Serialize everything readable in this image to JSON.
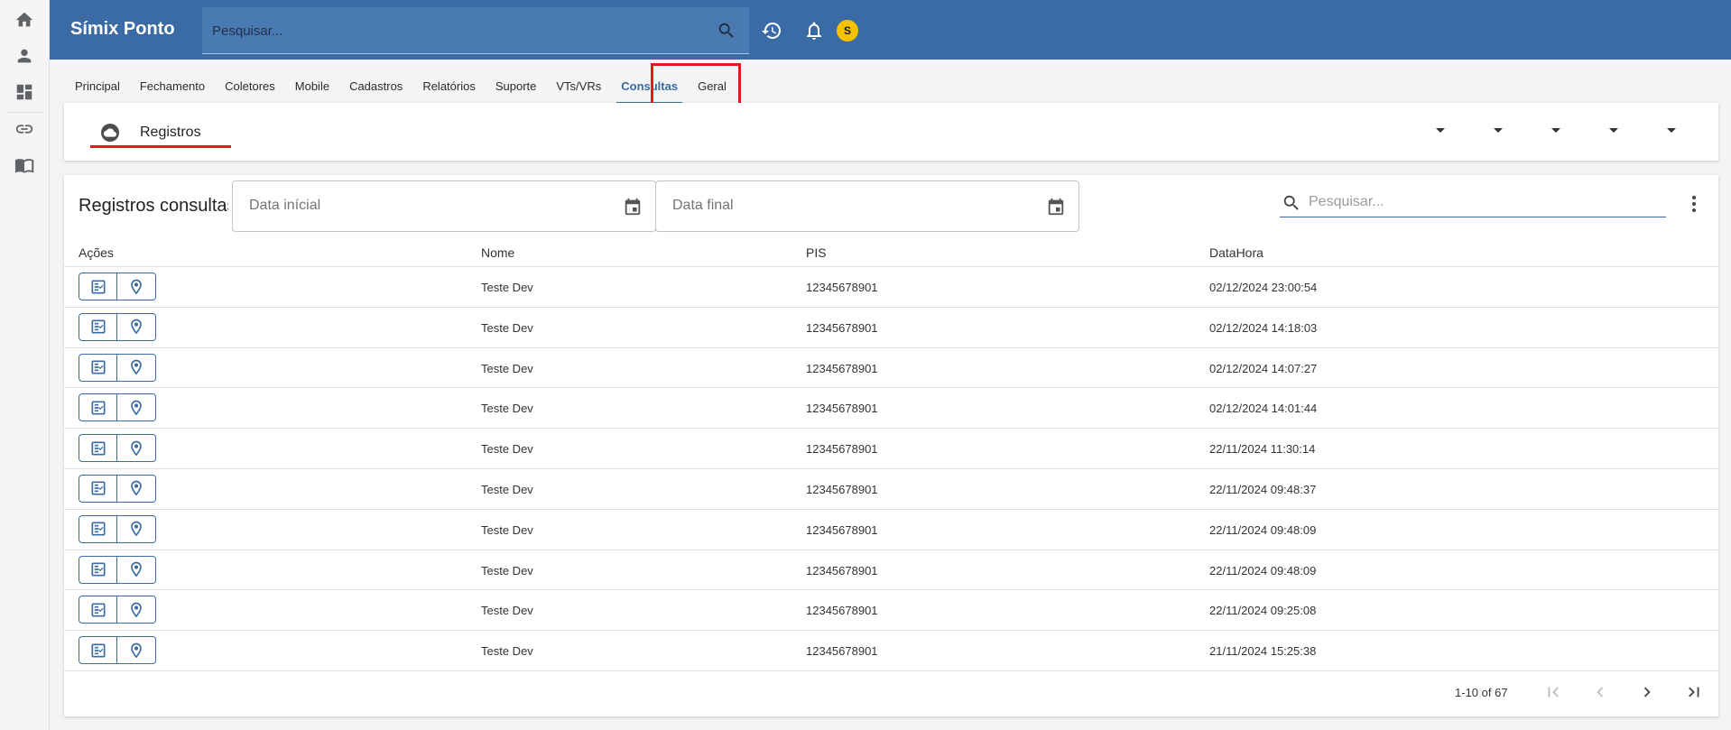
{
  "app": {
    "title": "Símix Ponto",
    "search_placeholder": "Pesquisar...",
    "avatar_initial": "S"
  },
  "nav": [
    "Principal",
    "Fechamento",
    "Coletores",
    "Mobile",
    "Cadastros",
    "Relatórios",
    "Suporte",
    "VTs/VRs",
    "Consultas",
    "Geral"
  ],
  "nav_active": "Consultas",
  "subnav": {
    "tab_label": "Registros"
  },
  "card": {
    "title": "Registros consultas",
    "start_date_placeholder": "Data inícial",
    "end_date_placeholder": "Data final",
    "search_placeholder": "Pesquisar..."
  },
  "table": {
    "headers": {
      "actions": "Ações",
      "name": "Nome",
      "pis": "PIS",
      "datetime": "DataHora"
    },
    "rows": [
      {
        "name": "Teste Dev",
        "pis": "12345678901",
        "datetime": "02/12/2024 23:00:54"
      },
      {
        "name": "Teste Dev",
        "pis": "12345678901",
        "datetime": "02/12/2024 14:18:03"
      },
      {
        "name": "Teste Dev",
        "pis": "12345678901",
        "datetime": "02/12/2024 14:07:27"
      },
      {
        "name": "Teste Dev",
        "pis": "12345678901",
        "datetime": "02/12/2024 14:01:44"
      },
      {
        "name": "Teste Dev",
        "pis": "12345678901",
        "datetime": "22/11/2024 11:30:14"
      },
      {
        "name": "Teste Dev",
        "pis": "12345678901",
        "datetime": "22/11/2024 09:48:37"
      },
      {
        "name": "Teste Dev",
        "pis": "12345678901",
        "datetime": "22/11/2024 09:48:09"
      },
      {
        "name": "Teste Dev",
        "pis": "12345678901",
        "datetime": "22/11/2024 09:48:09"
      },
      {
        "name": "Teste Dev",
        "pis": "12345678901",
        "datetime": "22/11/2024 09:25:08"
      },
      {
        "name": "Teste Dev",
        "pis": "12345678901",
        "datetime": "21/11/2024 15:25:38"
      }
    ]
  },
  "pagination": {
    "label": "1-10 of 67"
  },
  "colors": {
    "primary": "#3a6ba5",
    "highlight": "#e01b1b",
    "avatar": "#f2c100"
  }
}
